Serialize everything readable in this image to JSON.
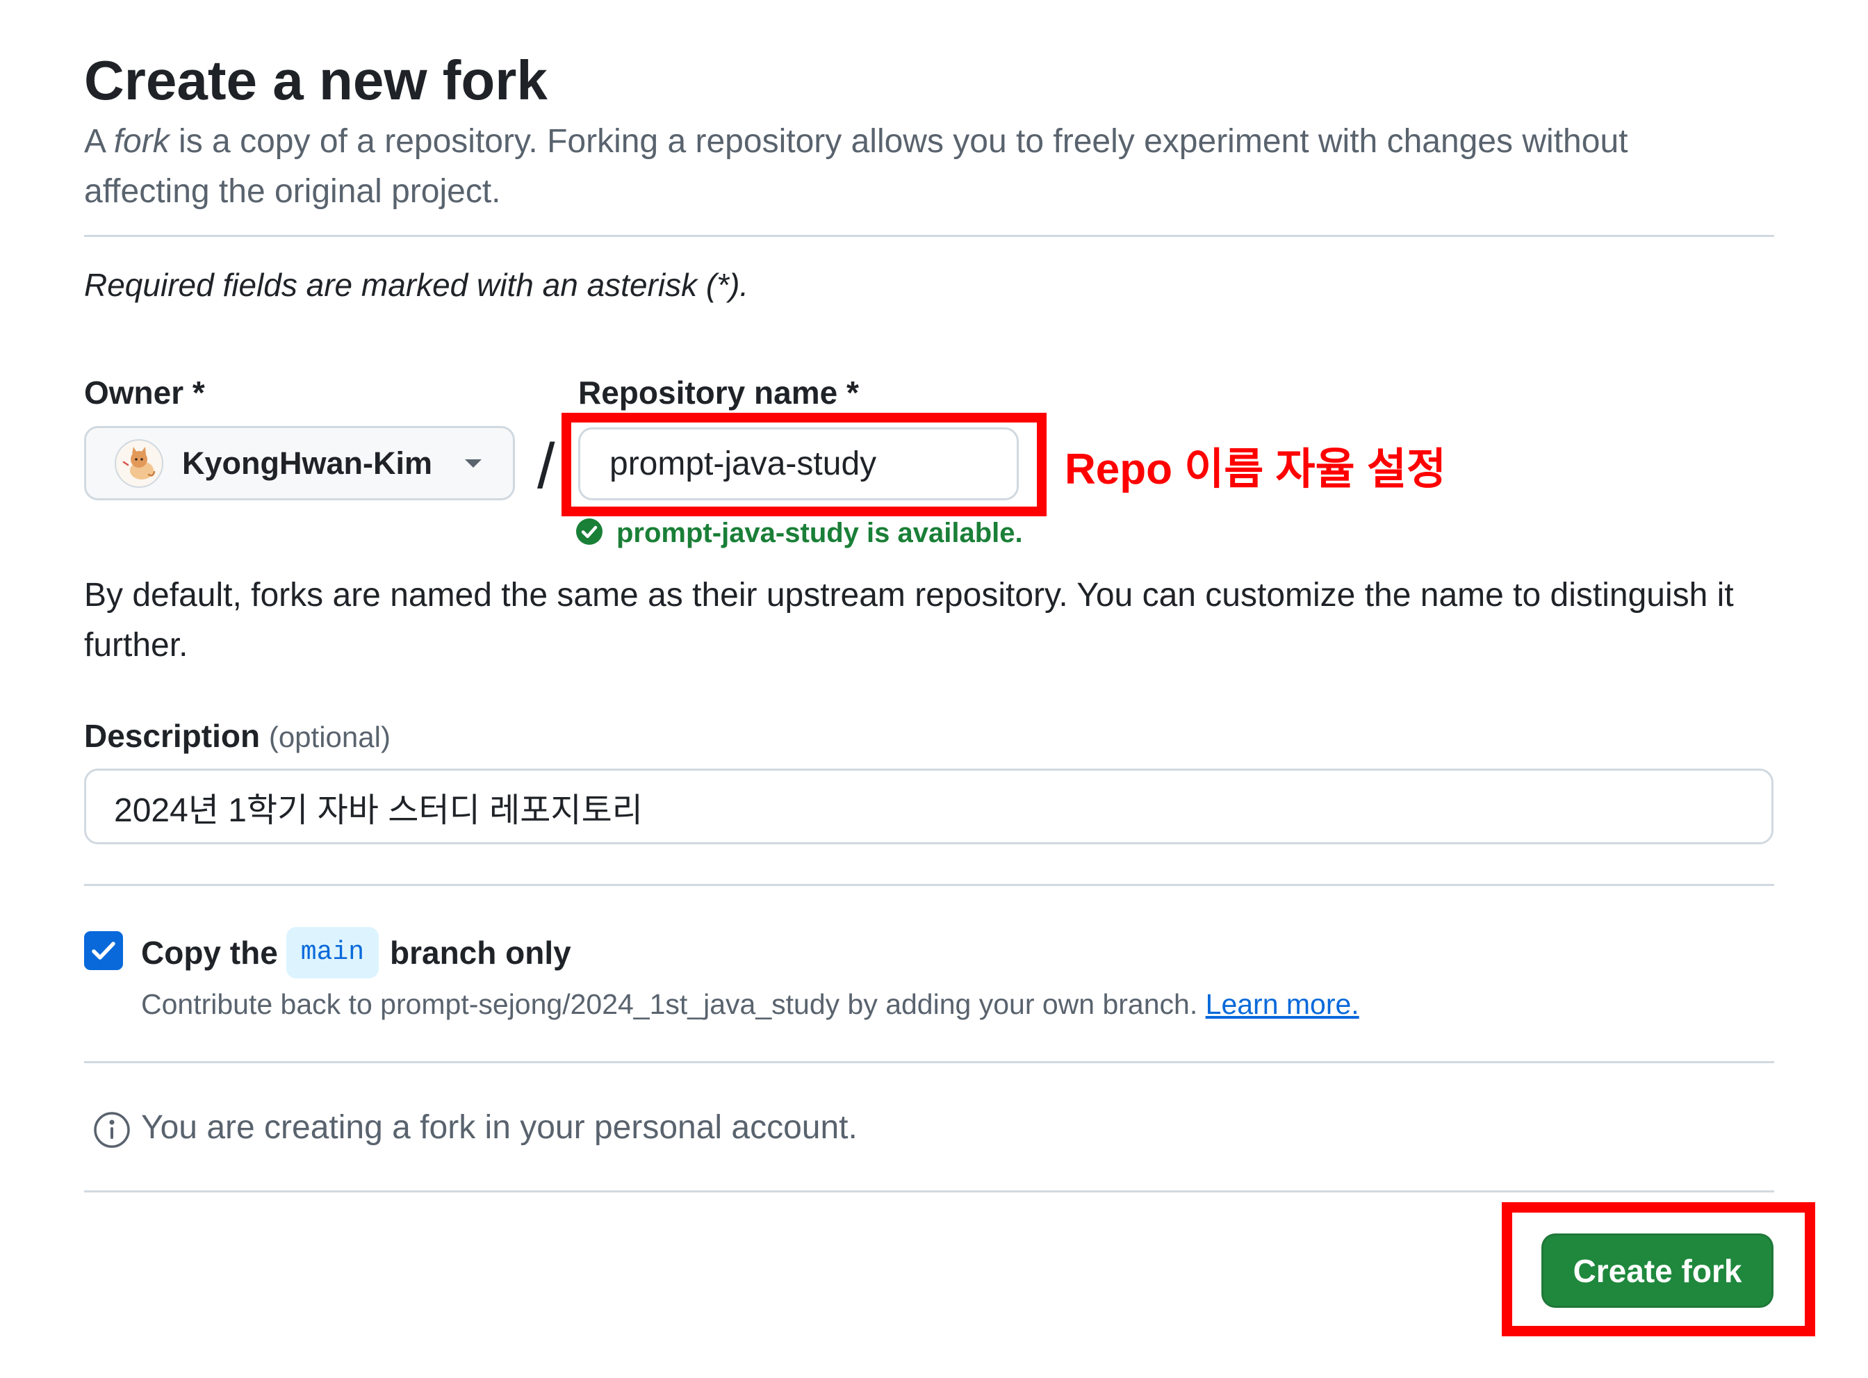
{
  "page": {
    "title": "Create a new fork",
    "intro": {
      "prefix": "A ",
      "emphasis": "fork",
      "suffix": " is a copy of a repository. Forking a repository allows you to freely experiment with changes without affecting the original project."
    },
    "required_note": "Required fields are marked with an asterisk (*)."
  },
  "form": {
    "owner": {
      "label": "Owner *",
      "value": "KyongHwan-Kim"
    },
    "separator": "/",
    "repository_name": {
      "label": "Repository name *",
      "value": "prompt-java-study",
      "availability_message": "prompt-java-study is available."
    },
    "name_hint": "By default, forks are named the same as their upstream repository. You can customize the name to distinguish it further.",
    "description": {
      "label": "Description",
      "optional_tag": "(optional)",
      "value": "2024년 1학기 자바 스터디 레포지토리"
    },
    "copy_main_branch": {
      "checked": true,
      "label_before": "Copy the",
      "branch_name": "main",
      "label_after": "branch only",
      "caption": "Contribute back to prompt-sejong/2024_1st_java_study by adding your own branch.",
      "learn_more_link": "Learn more."
    },
    "account_note": "You are creating a fork in your personal account.",
    "submit_label": "Create fork"
  },
  "annotation": {
    "label": "Repo 이름 자율 설정"
  },
  "icons": {
    "owner_avatar": "avatar",
    "owner_dropdown": "caret-down-icon",
    "availability": "check-circle-icon",
    "checkbox": "checkmark-icon",
    "account_note": "info-icon"
  },
  "colors": {
    "text": "#1f2328",
    "muted": "#59636e",
    "border": "#d1d9e0",
    "accent": "#0969da",
    "success": "#1a7f37",
    "primary_button": "#1f883d",
    "branch_pill_bg": "#ddf4ff",
    "annotation": "#ff0000"
  }
}
